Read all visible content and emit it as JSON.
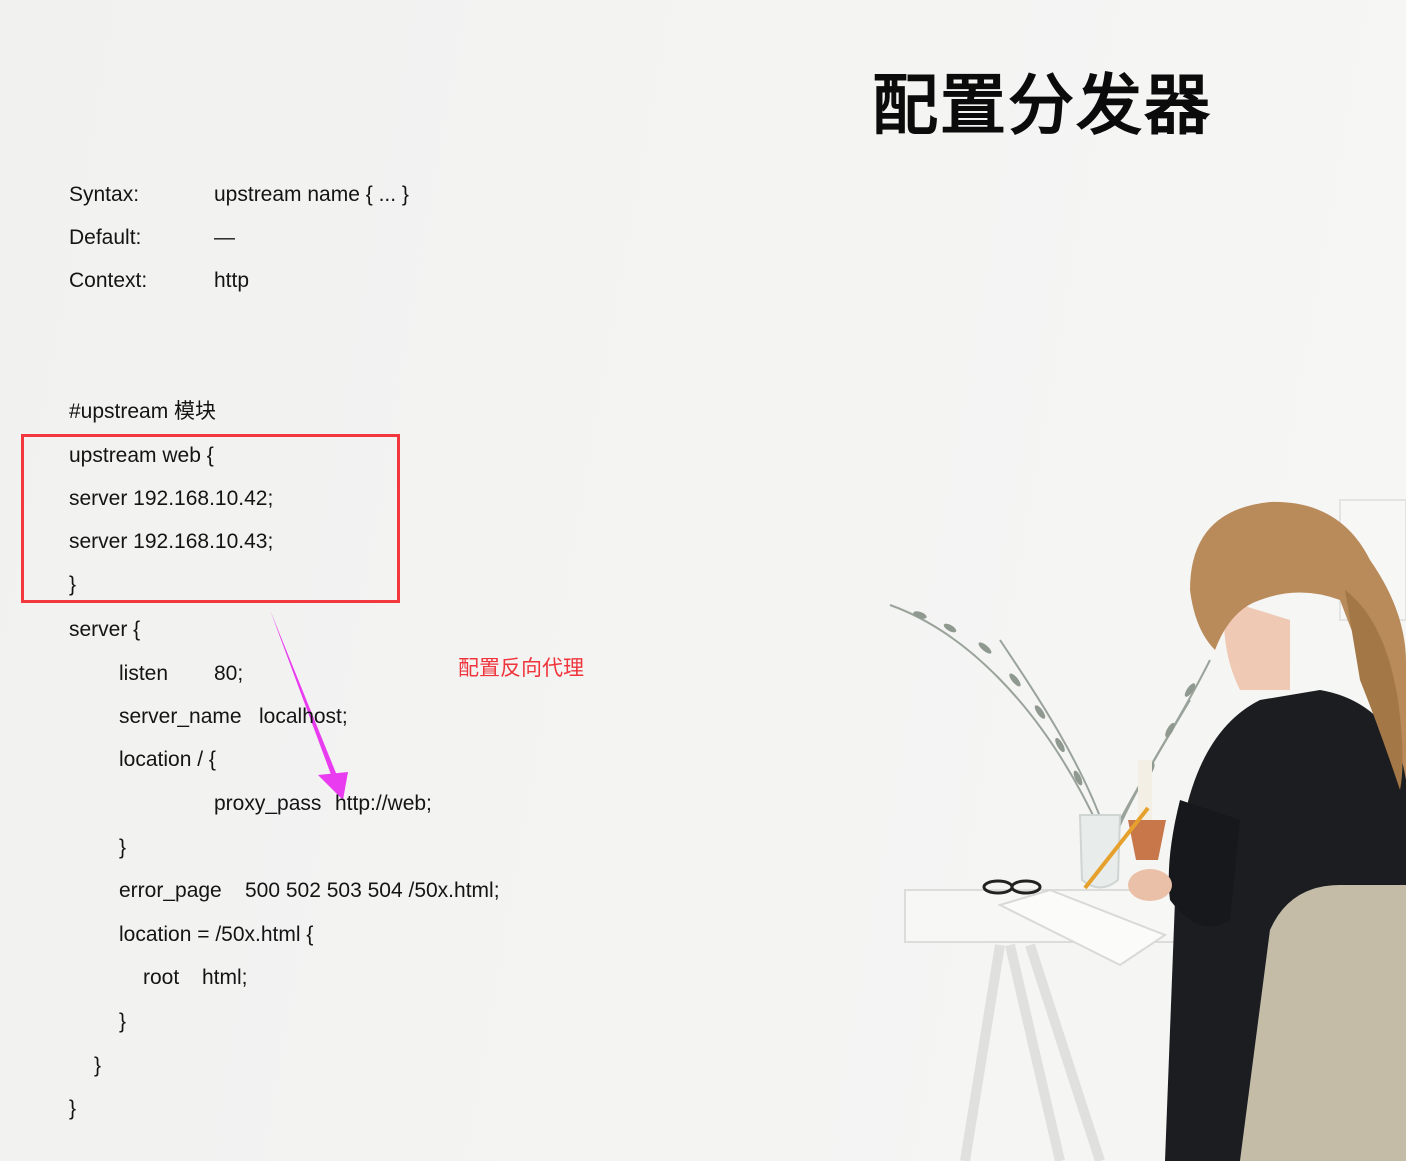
{
  "slide": {
    "title": "配置分发器",
    "syntax": {
      "syntax_label": "Syntax:",
      "syntax_value": "upstream name { ... }",
      "default_label": "Default:",
      "default_value": "—",
      "context_label": "Context:",
      "context_value": "http"
    },
    "code": {
      "comment": "#upstream 模块",
      "upstream_open": "upstream web {",
      "server1": "server 192.168.10.42;",
      "server2": "server 192.168.10.43;",
      "upstream_close": "}",
      "server_open": "server {",
      "listen_key": "listen",
      "listen_value": "80;",
      "server_name_key": "server_name",
      "server_name_value": "localhost;",
      "location_root": "location / {",
      "proxy_pass_key": "proxy_pass",
      "proxy_pass_value": "http://web;",
      "location_root_close": "}",
      "error_page_key": "error_page",
      "error_page_value": "500 502 503 504  /50x.html;",
      "location_50x": "location = /50x.html {",
      "root_key": "root",
      "root_value": "html;",
      "location_50x_close": "}",
      "server_close": "}",
      "outer_close": "}"
    },
    "annotation": {
      "label": "配置反向代理",
      "color": "#f0343c",
      "arrow_color": "#e93cf0"
    },
    "box_color": "#f2383e",
    "photo": {
      "subject": "woman writing at a small white desk with plant vase"
    }
  }
}
